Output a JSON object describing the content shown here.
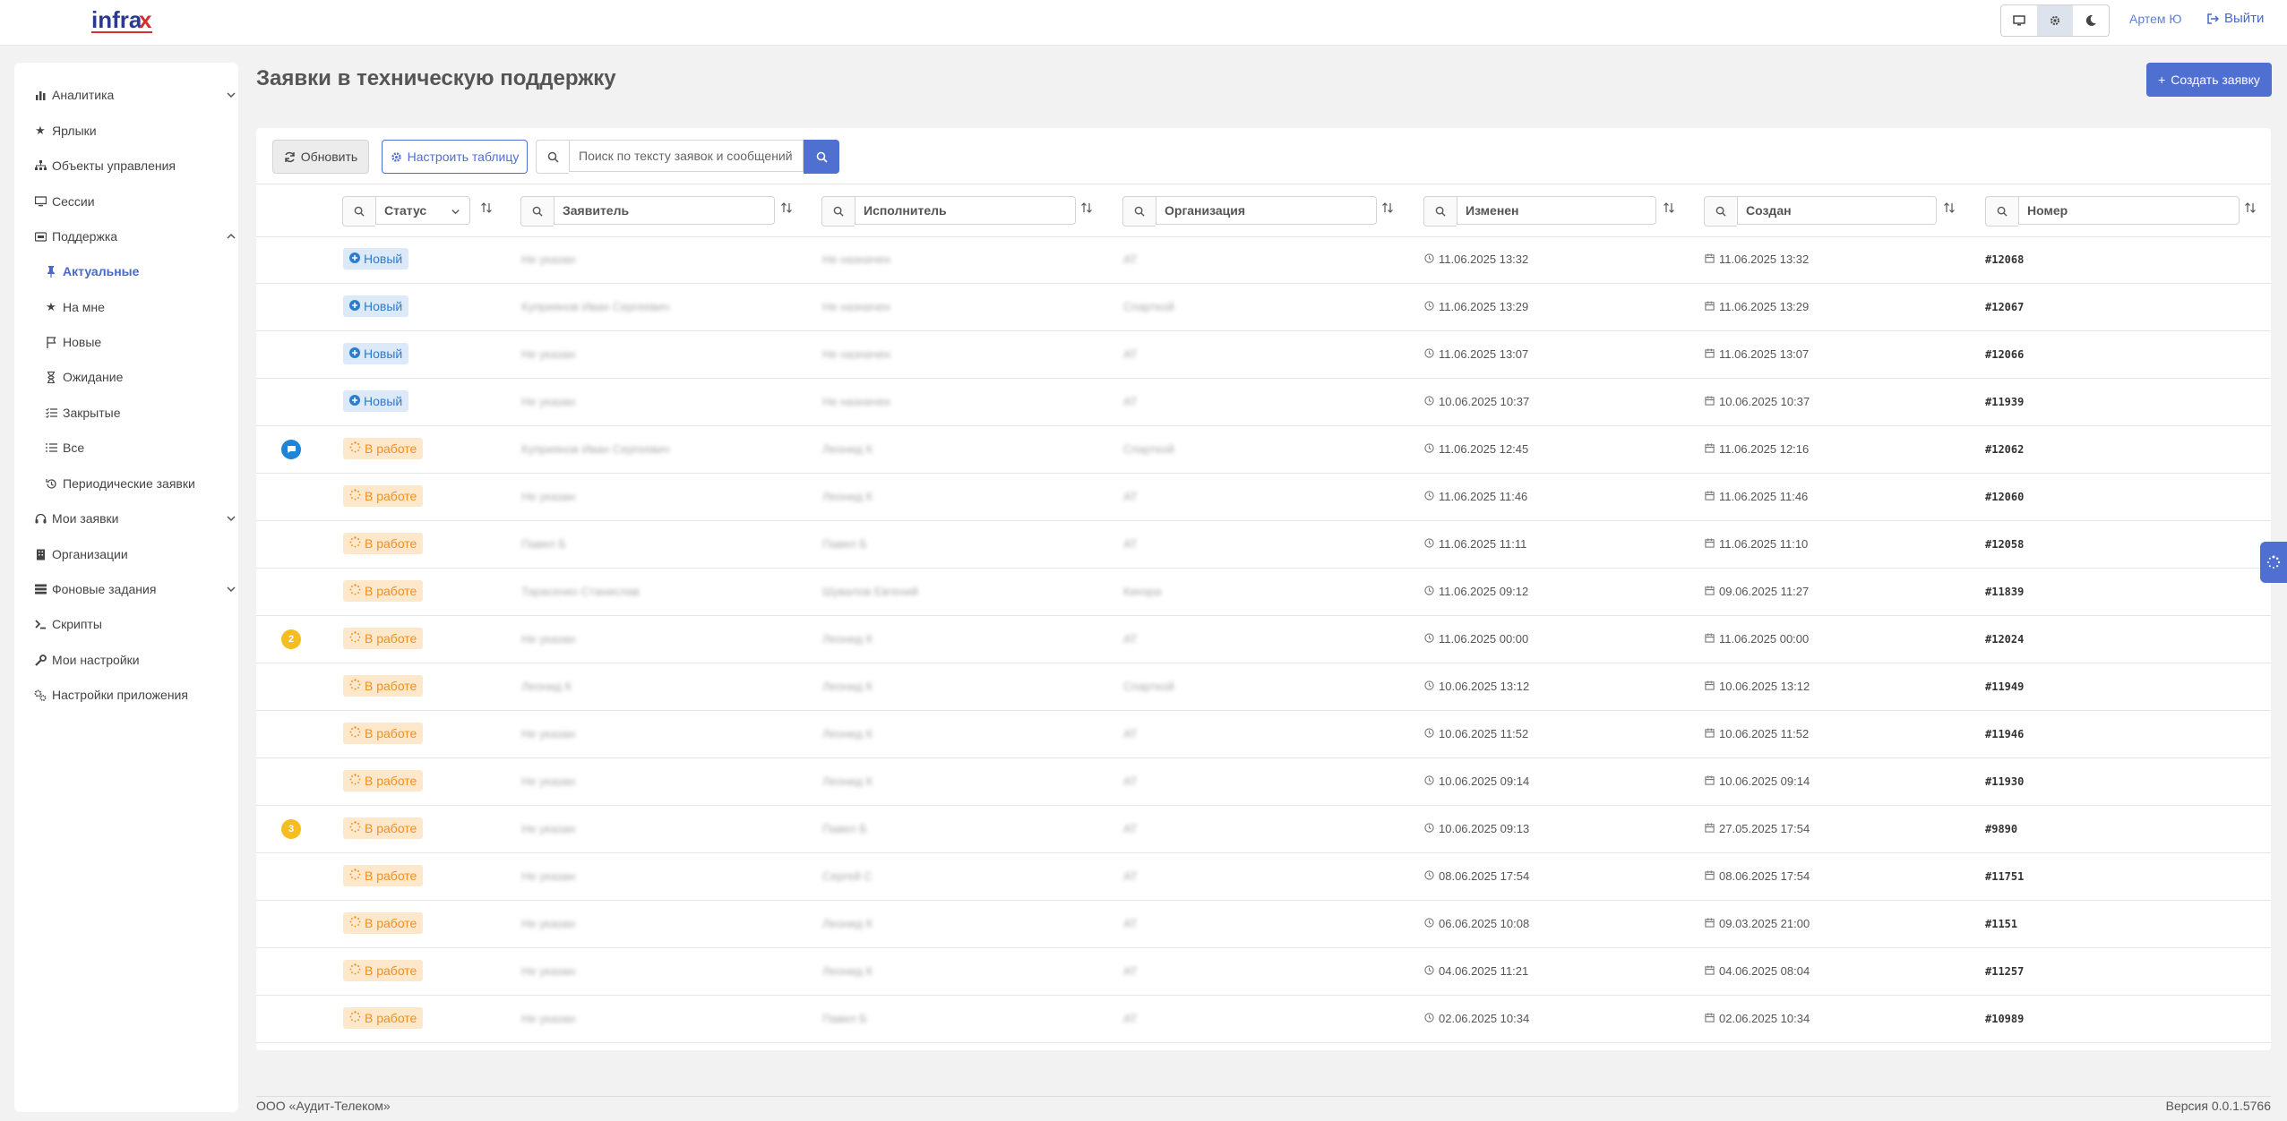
{
  "header": {
    "logo_text": "infrax",
    "user_link": "Артем Ю",
    "logout": "Выйти"
  },
  "sidebar": {
    "items": [
      {
        "label": "Аналитика",
        "icon": "chart-bar-icon"
      },
      {
        "label": "Ярлыки",
        "icon": "star-icon"
      },
      {
        "label": "Объекты управления",
        "icon": "sitemap-icon"
      },
      {
        "label": "Сессии",
        "icon": "monitor-icon"
      },
      {
        "label": "Поддержка",
        "icon": "ticket-icon"
      },
      {
        "label": "Актуальные",
        "icon": "thumbtack-icon"
      },
      {
        "label": "На мне",
        "icon": "star-icon"
      },
      {
        "label": "Новые",
        "icon": "flag-icon"
      },
      {
        "label": "Ожидание",
        "icon": "hourglass-icon"
      },
      {
        "label": "Закрытые",
        "icon": "list-check-icon"
      },
      {
        "label": "Все",
        "icon": "list-icon"
      },
      {
        "label": "Периодические заявки",
        "icon": "history-icon"
      },
      {
        "label": "Мои заявки",
        "icon": "headset-icon"
      },
      {
        "label": "Организации",
        "icon": "building-icon"
      },
      {
        "label": "Фоновые задания",
        "icon": "tasks-icon"
      },
      {
        "label": "Скрипты",
        "icon": "terminal-icon"
      },
      {
        "label": "Мои настройки",
        "icon": "wrench-icon"
      },
      {
        "label": "Настройки приложения",
        "icon": "cogs-icon"
      }
    ]
  },
  "main": {
    "title": "Заявки в техническую поддержку",
    "create_label": "Создать заявку",
    "refresh_label": "Обновить",
    "configure_label": "Настроить таблицу",
    "search_placeholder": "Поиск по тексту заявок и сообщений"
  },
  "columns": {
    "status": "Статус",
    "applicant": "Заявитель",
    "executor": "Исполнитель",
    "organization": "Организация",
    "modified": "Изменен",
    "created": "Создан",
    "number": "Номер"
  },
  "rows": [
    {
      "status": "Новый",
      "applicant": "Не указан",
      "executor": "Не назначен",
      "org": "АТ",
      "modified": "11.06.2025 13:32",
      "created": "11.06.2025 13:32",
      "number": "#12068",
      "indicator": ""
    },
    {
      "status": "Новый",
      "applicant": "Куприянов Иван Сергеевич",
      "executor": "Не назначен",
      "org": "Спарткой",
      "modified": "11.06.2025 13:29",
      "created": "11.06.2025 13:29",
      "number": "#12067",
      "indicator": ""
    },
    {
      "status": "Новый",
      "applicant": "Не указан",
      "executor": "Не назначен",
      "org": "АТ",
      "modified": "11.06.2025 13:07",
      "created": "11.06.2025 13:07",
      "number": "#12066",
      "indicator": ""
    },
    {
      "status": "Новый",
      "applicant": "Не указан",
      "executor": "Не назначен",
      "org": "АТ",
      "modified": "10.06.2025 10:37",
      "created": "10.06.2025 10:37",
      "number": "#11939",
      "indicator": ""
    },
    {
      "status": "В работе",
      "applicant": "Куприянов Иван Сергеевич",
      "executor": "Леонид К",
      "org": "Спарткой",
      "modified": "11.06.2025 12:45",
      "created": "11.06.2025 12:16",
      "number": "#12062",
      "indicator": "chat"
    },
    {
      "status": "В работе",
      "applicant": "Не указан",
      "executor": "Леонид К",
      "org": "АТ",
      "modified": "11.06.2025 11:46",
      "created": "11.06.2025 11:46",
      "number": "#12060",
      "indicator": ""
    },
    {
      "status": "В работе",
      "applicant": "Павел Б",
      "executor": "Павел Б",
      "org": "АТ",
      "modified": "11.06.2025 11:11",
      "created": "11.06.2025 11:10",
      "number": "#12058",
      "indicator": ""
    },
    {
      "status": "В работе",
      "applicant": "Тарасенко Станислав",
      "executor": "Шувалов Евгений",
      "org": "Кинзра",
      "modified": "11.06.2025 09:12",
      "created": "09.06.2025 11:27",
      "number": "#11839",
      "indicator": ""
    },
    {
      "status": "В работе",
      "applicant": "Не указан",
      "executor": "Леонид К",
      "org": "АТ",
      "modified": "11.06.2025 00:00",
      "created": "11.06.2025 00:00",
      "number": "#12024",
      "indicator": "2"
    },
    {
      "status": "В работе",
      "applicant": "Леонид К",
      "executor": "Леонид К",
      "org": "Спарткой",
      "modified": "10.06.2025 13:12",
      "created": "10.06.2025 13:12",
      "number": "#11949",
      "indicator": ""
    },
    {
      "status": "В работе",
      "applicant": "Не указан",
      "executor": "Леонид К",
      "org": "АТ",
      "modified": "10.06.2025 11:52",
      "created": "10.06.2025 11:52",
      "number": "#11946",
      "indicator": ""
    },
    {
      "status": "В работе",
      "applicant": "Не указан",
      "executor": "Леонид К",
      "org": "АТ",
      "modified": "10.06.2025 09:14",
      "created": "10.06.2025 09:14",
      "number": "#11930",
      "indicator": ""
    },
    {
      "status": "В работе",
      "applicant": "Не указан",
      "executor": "Павел Б",
      "org": "АТ",
      "modified": "10.06.2025 09:13",
      "created": "27.05.2025 17:54",
      "number": "#9890",
      "indicator": "3"
    },
    {
      "status": "В работе",
      "applicant": "Не указан",
      "executor": "Сергей С",
      "org": "АТ",
      "modified": "08.06.2025 17:54",
      "created": "08.06.2025 17:54",
      "number": "#11751",
      "indicator": ""
    },
    {
      "status": "В работе",
      "applicant": "Не указан",
      "executor": "Леонид К",
      "org": "АТ",
      "modified": "06.06.2025 10:08",
      "created": "09.03.2025 21:00",
      "number": "#1151",
      "indicator": ""
    },
    {
      "status": "В работе",
      "applicant": "Не указан",
      "executor": "Леонид К",
      "org": "АТ",
      "modified": "04.06.2025 11:21",
      "created": "04.06.2025 08:04",
      "number": "#11257",
      "indicator": ""
    },
    {
      "status": "В работе",
      "applicant": "Не указан",
      "executor": "Павел Б",
      "org": "АТ",
      "modified": "02.06.2025 10:34",
      "created": "02.06.2025 10:34",
      "number": "#10989",
      "indicator": ""
    }
  ],
  "footer": {
    "company": "ООО «Аудит-Телеком»",
    "version": "Версия 0.0.1.5766"
  },
  "colors": {
    "accent": "#4f6fd1",
    "status_new_bg": "#dbe9f8",
    "status_new_fg": "#2c7cd0",
    "status_work_bg": "#fde8cc",
    "status_work_fg": "#f09020"
  }
}
